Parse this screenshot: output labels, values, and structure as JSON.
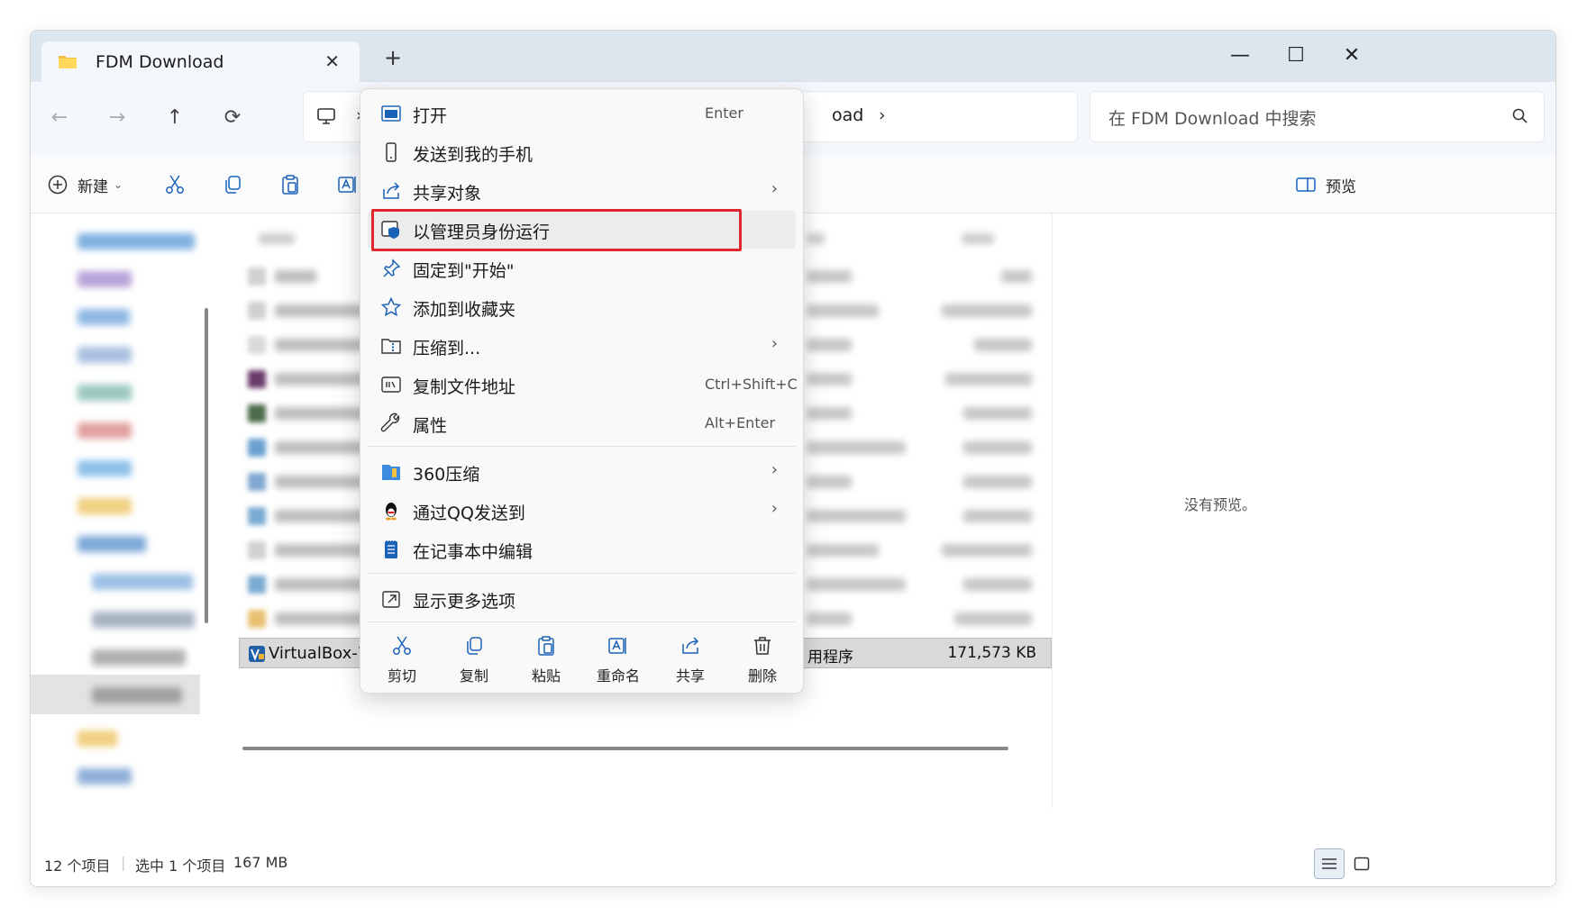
{
  "window": {
    "tab_title": "FDM Download",
    "new_tab": "+",
    "controls": {
      "minimize": "—",
      "maximize": "☐",
      "close": "✕"
    }
  },
  "nav": {
    "back": "←",
    "forward": "→",
    "up": "↑",
    "refresh": "⟳",
    "breadcrumb_tail": "oad",
    "breadcrumb_sep": "›",
    "search_placeholder": "在 FDM Download 中搜索"
  },
  "commandbar": {
    "new_label": "新建",
    "preview_label": "预览"
  },
  "files": {
    "selected": {
      "name": "VirtualBox-7.2",
      "type": "用程序",
      "size": "171,573 KB"
    }
  },
  "preview": {
    "message": "没有预览。"
  },
  "status": {
    "item_count": "12 个项目",
    "selection": "选中 1 个项目",
    "selection_size": "167 MB"
  },
  "context_menu": {
    "items": [
      {
        "label": "打开",
        "shortcut": "Enter",
        "icon": "open-icon"
      },
      {
        "label": "发送到我的手机",
        "shortcut": "",
        "icon": "phone-icon"
      },
      {
        "label": "共享对象",
        "shortcut": "",
        "icon": "share-icon",
        "submenu": true
      },
      {
        "label": "以管理员身份运行",
        "shortcut": "",
        "icon": "admin-shield-icon",
        "highlighted": true
      },
      {
        "label": "固定到\"开始\"",
        "shortcut": "",
        "icon": "pin-icon"
      },
      {
        "label": "添加到收藏夹",
        "shortcut": "",
        "icon": "star-icon"
      },
      {
        "label": "压缩到...",
        "shortcut": "",
        "icon": "zip-icon",
        "submenu": true
      },
      {
        "label": "复制文件地址",
        "shortcut": "Ctrl+Shift+C",
        "icon": "copy-path-icon"
      },
      {
        "label": "属性",
        "shortcut": "Alt+Enter",
        "icon": "wrench-icon"
      },
      {
        "label": "360压缩",
        "shortcut": "",
        "icon": "360zip-icon",
        "submenu": true
      },
      {
        "label": "通过QQ发送到",
        "shortcut": "",
        "icon": "qq-icon",
        "submenu": true
      },
      {
        "label": "在记事本中编辑",
        "shortcut": "",
        "icon": "notepad-icon"
      },
      {
        "label": "显示更多选项",
        "shortcut": "",
        "icon": "more-options-icon"
      }
    ],
    "submenu_arrow": "›",
    "quick_actions": [
      {
        "label": "剪切",
        "icon": "cut-icon"
      },
      {
        "label": "复制",
        "icon": "copy-icon"
      },
      {
        "label": "粘贴",
        "icon": "paste-icon"
      },
      {
        "label": "重命名",
        "icon": "rename-icon"
      },
      {
        "label": "共享",
        "icon": "share-icon"
      },
      {
        "label": "删除",
        "icon": "delete-icon"
      }
    ]
  },
  "colors": {
    "highlight_border": "#e0272d",
    "titlebar": "#dde5ee",
    "accent": "#0067c0"
  }
}
